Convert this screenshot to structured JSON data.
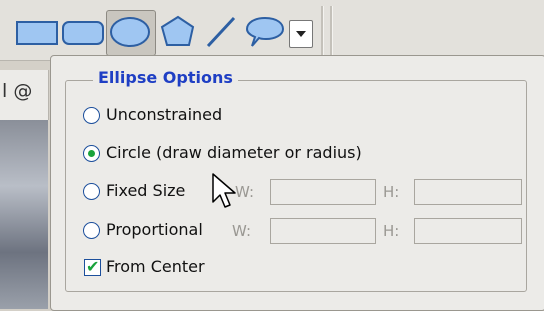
{
  "toolbar": {
    "tools": [
      {
        "icon": "rectangle-shape-icon"
      },
      {
        "icon": "rounded-rectangle-shape-icon"
      },
      {
        "icon": "ellipse-shape-icon"
      },
      {
        "icon": "polygon-shape-icon"
      },
      {
        "icon": "line-shape-icon"
      },
      {
        "icon": "custom-shape-icon"
      }
    ],
    "dropdown_icon": "chevron-down-icon"
  },
  "document": {
    "tab_fragment": "l @"
  },
  "options": {
    "title": "Ellipse Options",
    "unconstrained": {
      "label": "Unconstrained",
      "checked": false
    },
    "circle": {
      "label": "Circle (draw diameter or radius)",
      "checked": true
    },
    "fixed_size": {
      "label": "Fixed Size",
      "checked": false,
      "w_label": "W:",
      "h_label": "H:",
      "w_value": "",
      "h_value": ""
    },
    "proportional": {
      "label": "Proportional",
      "checked": false,
      "w_label": "W:",
      "h_label": "H:",
      "w_value": "",
      "h_value": ""
    },
    "from_center": {
      "label": "From Center",
      "checked": true
    }
  },
  "colors": {
    "title": "#1f3fc4",
    "radio_border": "#1c4f9c",
    "checked": "#1aa33b",
    "shape_fill": "#9fc6f2",
    "shape_stroke": "#2d5fa3"
  }
}
